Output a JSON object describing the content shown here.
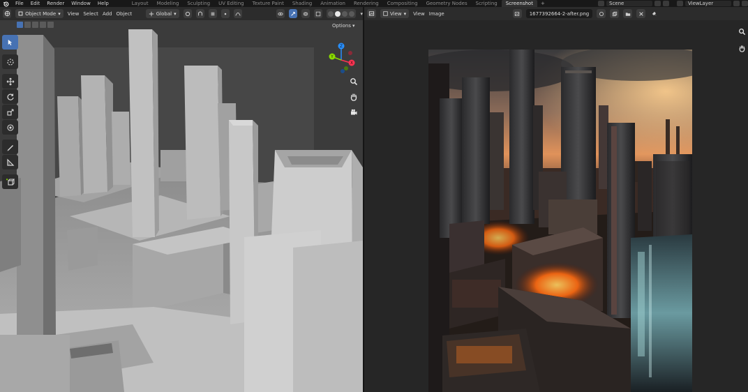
{
  "top_menu": {
    "items": [
      "File",
      "Edit",
      "Render",
      "Window",
      "Help"
    ]
  },
  "workspaces": {
    "tabs": [
      "Layout",
      "Modeling",
      "Sculpting",
      "UV Editing",
      "Texture Paint",
      "Shading",
      "Animation",
      "Rendering",
      "Compositing",
      "Geometry Nodes",
      "Scripting",
      "Screenshot"
    ],
    "active": "Screenshot",
    "add_label": "+"
  },
  "scene": {
    "name": "Scene"
  },
  "view_layer": {
    "name": "ViewLayer"
  },
  "viewport": {
    "mode_label": "Object Mode",
    "menus": [
      "View",
      "Select",
      "Add",
      "Object"
    ],
    "orientation_label": "Global",
    "options_label": "Options",
    "gizmo_axes": {
      "x": "X",
      "y": "Y",
      "z": "Z"
    }
  },
  "image_editor": {
    "menus": [
      "View",
      "View",
      "Image"
    ],
    "image_name": "1677392664-2-after.png"
  },
  "colors": {
    "accent": "#4772b3",
    "axis_x": "#ff3352",
    "axis_y": "#8bdc00",
    "axis_z": "#2890ff",
    "topbar_bg": "#181818",
    "header_bg": "#2c2c2c"
  },
  "icons": {
    "blender_logo": "blender-logo-icon",
    "tools": [
      "select-box-icon",
      "cursor-icon",
      "move-icon",
      "rotate-icon",
      "scale-icon",
      "transform-icon",
      "annotate-icon",
      "measure-icon",
      "add-cube-icon"
    ],
    "nav": [
      "zoom-icon",
      "hand-pan-icon",
      "camera-view-icon"
    ]
  }
}
